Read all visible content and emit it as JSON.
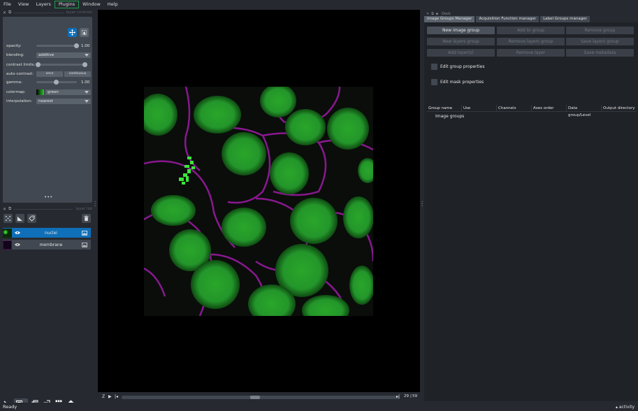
{
  "menu": [
    "File",
    "View",
    "Layers",
    "Plugins",
    "Window",
    "Help"
  ],
  "layer_controls": {
    "title": "layer controls",
    "opacity_label": "opacity:",
    "opacity_value": "1.00",
    "opacity_level": 1.0,
    "blending_label": "blending:",
    "blending_value": "additive",
    "contrast_label": "contrast limits:",
    "autocontrast_label": "auto-contrast:",
    "autocontrast_once": "once",
    "autocontrast_continuous": "continuous",
    "gamma_label": "gamma:",
    "gamma_value": "1.00",
    "gamma_level": 0.5,
    "colormap_label": "colormap:",
    "colormap_value": "green",
    "interp_label": "interpolation:",
    "interp_value": "nearest"
  },
  "layer_list": {
    "title": "layer list",
    "layers": [
      {
        "name": "nuclei",
        "selected": true
      },
      {
        "name": "membrane",
        "selected": false
      }
    ]
  },
  "dims": {
    "axis_label": "Z",
    "current": "29",
    "total": "59"
  },
  "dock": {
    "title": "Dock",
    "tabs": [
      "Image Groups Manager",
      "Acquisition Function manager",
      "Label Groups manager"
    ],
    "buttons": [
      {
        "label": "New image group",
        "enabled": true
      },
      {
        "label": "Add to group",
        "enabled": false
      },
      {
        "label": "Remove group",
        "enabled": false
      },
      {
        "label": "New layers group",
        "enabled": false
      },
      {
        "label": "Remove layers group",
        "enabled": false
      },
      {
        "label": "Save layers group",
        "enabled": false
      },
      {
        "label": "Add layer(s)",
        "enabled": false
      },
      {
        "label": "Remove layer",
        "enabled": false
      },
      {
        "label": "Save metadata",
        "enabled": false
      }
    ],
    "edit_group": "Edit group properties",
    "edit_mask": "Edit mask properties",
    "columns": [
      "Group name",
      "Use",
      "Channels",
      "Axes order",
      "Data group/Level",
      "Output directory"
    ],
    "tree_root": "Image groups"
  },
  "status": {
    "left": "Ready",
    "right": "activity"
  },
  "colors": {
    "accent_green": "#1f9d4b",
    "selection_blue": "#0f6fb8",
    "nuclei": "#2ec82e",
    "membrane": "#b01fb0"
  }
}
